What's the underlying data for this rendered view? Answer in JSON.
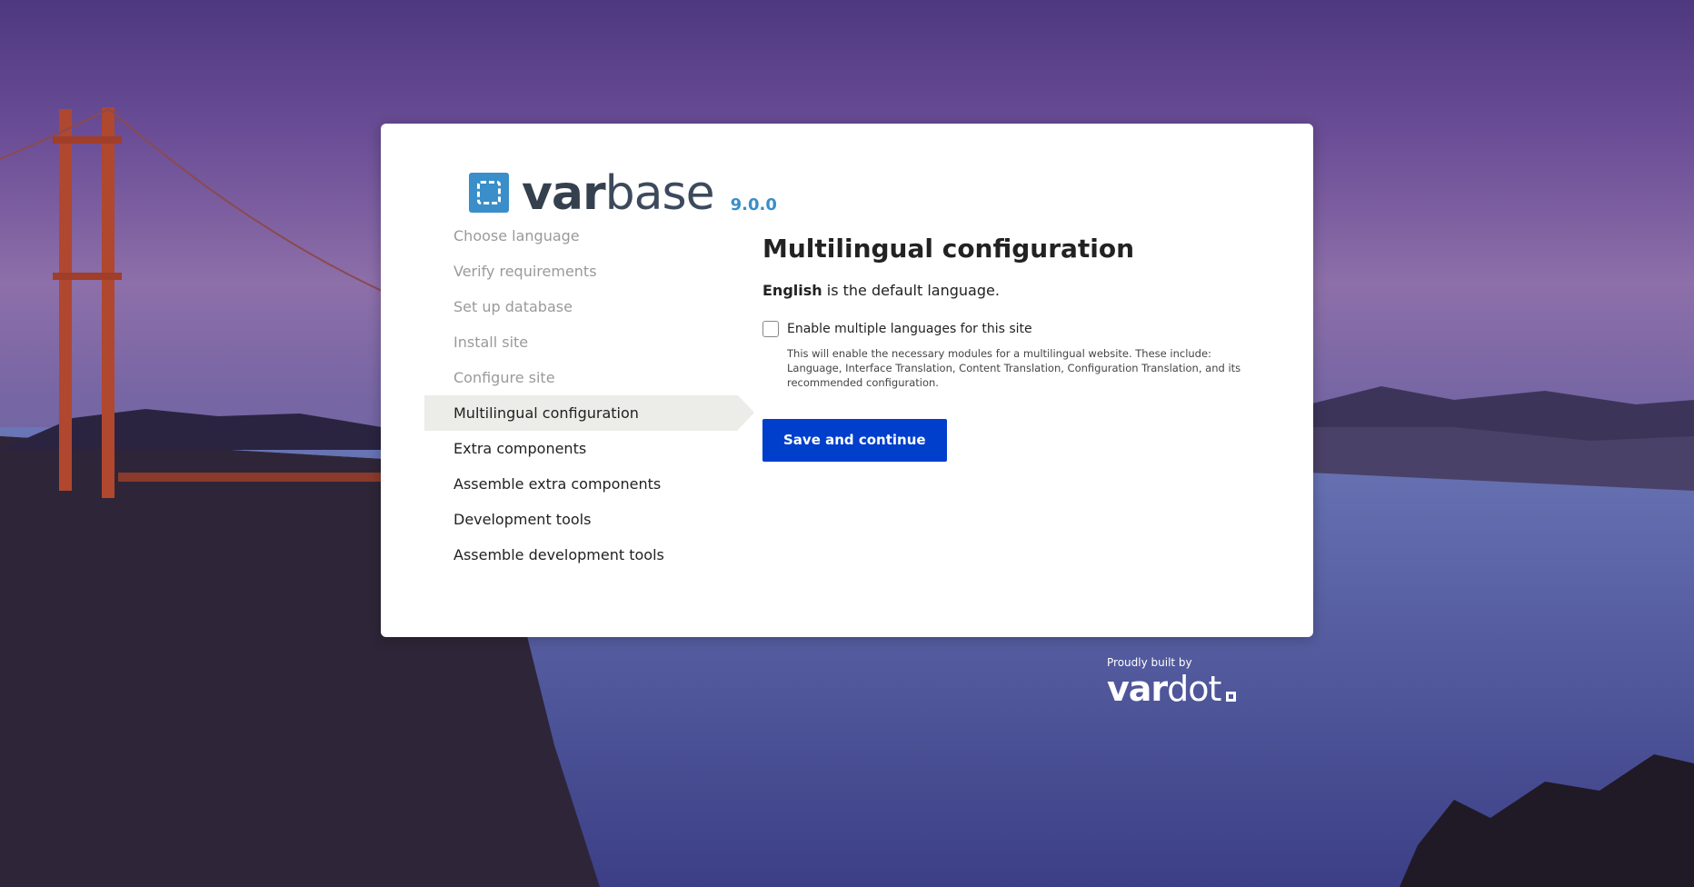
{
  "brand": {
    "name_bold": "var",
    "name_light": "base",
    "version": "9.0.0"
  },
  "steps": [
    {
      "label": "Choose language",
      "state": "done"
    },
    {
      "label": "Verify requirements",
      "state": "done"
    },
    {
      "label": "Set up database",
      "state": "done"
    },
    {
      "label": "Install site",
      "state": "done"
    },
    {
      "label": "Configure site",
      "state": "done"
    },
    {
      "label": "Multilingual configuration",
      "state": "active"
    },
    {
      "label": "Extra components",
      "state": "pending"
    },
    {
      "label": "Assemble extra components",
      "state": "pending"
    },
    {
      "label": "Development tools",
      "state": "pending"
    },
    {
      "label": "Assemble development tools",
      "state": "pending"
    }
  ],
  "content": {
    "title": "Multilingual configuration",
    "default_language": "English",
    "default_language_suffix": " is the default language.",
    "checkbox_label": "Enable multiple languages for this site",
    "checkbox_checked": false,
    "help_text": "This will enable the necessary modules for a multilingual website. These include: Language, Interface Translation, Content Translation, Configuration Translation, and its recommended configuration.",
    "submit_label": "Save and continue"
  },
  "footer": {
    "built_by": "Proudly built by",
    "company_bold": "var",
    "company_light": "dot"
  },
  "colors": {
    "primary_button": "#003ecc",
    "brand_blue": "#3a8ec9",
    "active_step_bg": "#ecece8"
  }
}
